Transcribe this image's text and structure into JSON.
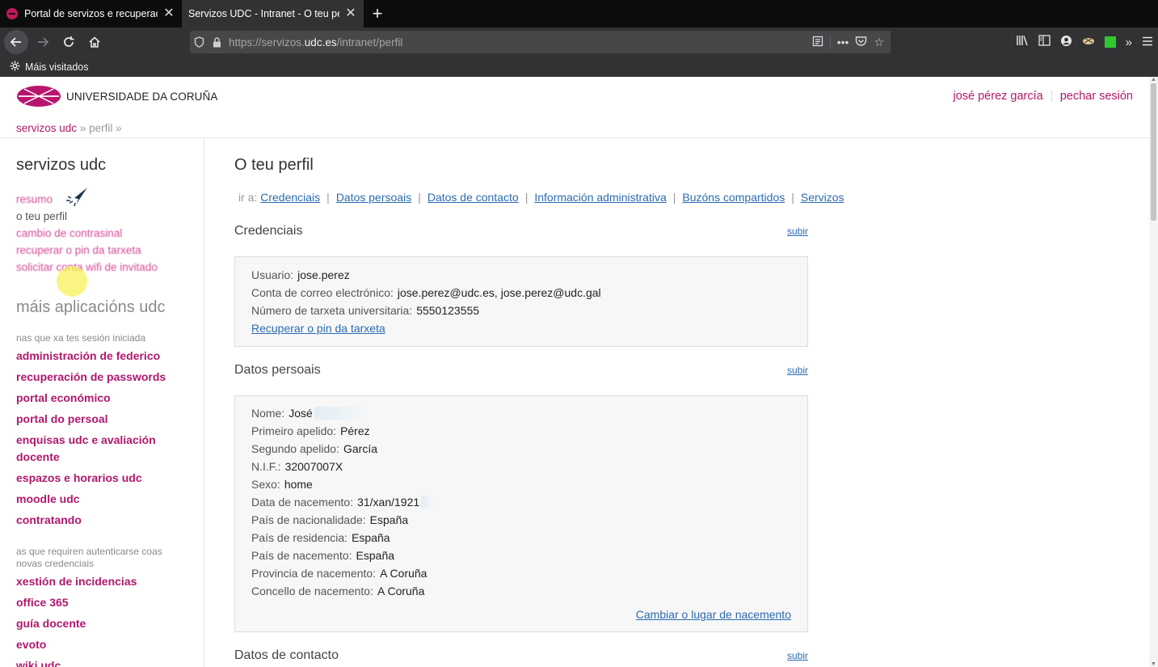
{
  "browser": {
    "tabs": [
      {
        "title": "Portal de servizos e recuperación",
        "active": false
      },
      {
        "title": "Servizos UDC - Intranet - O teu perfil",
        "active": true
      }
    ],
    "url_prefix": "https://servizos.",
    "url_domain": "udc.es",
    "url_path": "/intranet/perfil",
    "bookmark_label": "Máis visitados"
  },
  "header": {
    "logo_text": "UNIVERSIDADE DA CORUÑA",
    "user_name": "josé pérez garcía",
    "logout": "pechar sesión"
  },
  "breadcrumb": {
    "home": "servizos udc",
    "sep1": "»",
    "current": "perfil",
    "sep2": "»"
  },
  "sidebar": {
    "title": "servizos udc",
    "menu": [
      "resumo",
      "o teu perfil",
      "cambio de contrasinal",
      "recuperar o pin da tarxeta",
      "solicitar conta wifi de invitado"
    ],
    "apps_title": "máis aplicacións udc",
    "caption_logged": "nas que xa tes sesión iniciada",
    "apps_logged": [
      "administración de federico",
      "recuperación de passwords",
      "portal económico",
      "portal do persoal",
      "enquisas udc e avaliación docente",
      "espazos e horarios udc",
      "moodle udc",
      "contratando"
    ],
    "caption_new": "as que requiren autenticarse coas novas credenciais",
    "apps_new": [
      "xestión de incidencias",
      "office 365",
      "guía docente",
      "evoto",
      "wiki udc"
    ]
  },
  "main": {
    "title": "O teu perfil",
    "goto_label": "ir a:",
    "goto_links": [
      "Credenciais",
      "Datos persoais",
      "Datos de contacto",
      "Información administrativa",
      "Buzóns compartidos",
      "Servizos"
    ],
    "up_label": "subir",
    "credentials": {
      "title": "Credenciais",
      "rows": [
        {
          "label": "Usuario:",
          "value": "jose.perez"
        },
        {
          "label": "Conta de correo electrónico:",
          "value": "jose.perez@udc.es, jose.perez@udc.gal"
        },
        {
          "label": "Número de tarxeta universitaria:",
          "value": "5550123555"
        }
      ],
      "link": "Recuperar o pin da tarxeta"
    },
    "personal": {
      "title": "Datos persoais",
      "rows": [
        {
          "label": "Nome:",
          "value": "José"
        },
        {
          "label": "Primeiro apelido:",
          "value": "Pérez"
        },
        {
          "label": "Segundo apelido:",
          "value": "García"
        },
        {
          "label": "N.I.F.:",
          "value": "32007007X"
        },
        {
          "label": "Sexo:",
          "value": "home"
        },
        {
          "label": "Data de nacemento:",
          "value": "31/xan/1921"
        },
        {
          "label": "País de nacionalidade:",
          "value": "España"
        },
        {
          "label": "País de residencia:",
          "value": "España"
        },
        {
          "label": "País de nacemento:",
          "value": "España"
        },
        {
          "label": "Provincia de nacemento:",
          "value": "A Coruña"
        },
        {
          "label": "Concello de nacemento:",
          "value": "A Coruña"
        }
      ],
      "link": "Cambiar o lugar de nacemento"
    },
    "contact": {
      "title": "Datos de contacto"
    }
  },
  "colors": {
    "brand": "#b0186d",
    "link": "#2c6bb0"
  }
}
